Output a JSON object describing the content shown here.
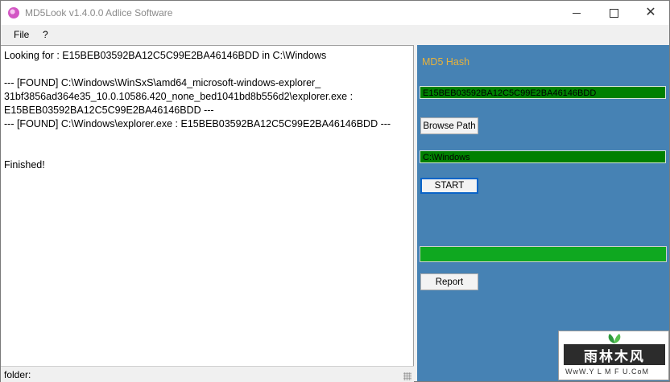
{
  "window": {
    "title": "MD5Look v1.4.0.0 Adlice Software",
    "minimize_icon": "minimize-icon",
    "maximize_icon": "maximize-icon",
    "close_glyph": "✕"
  },
  "menu": {
    "items": [
      "File",
      "?"
    ]
  },
  "output": {
    "lines": [
      "Looking for : E15BEB03592BA12C5C99E2BA46146BDD in C:\\Windows",
      "--- [FOUND] C:\\Windows\\WinSxS\\amd64_microsoft-windows-explorer_",
      "31bf3856ad364e35_10.0.10586.420_none_bed1041bd8b556d2\\explorer.exe :",
      "E15BEB03592BA12C5C99E2BA46146BDD ---",
      "--- [FOUND] C:\\Windows\\explorer.exe : E15BEB03592BA12C5C99E2BA46146BDD ---",
      "Finished!"
    ]
  },
  "sidebar": {
    "md5_label": "MD5 Hash",
    "hash_value": "E15BEB03592BA12C5C99E2BA46146BDD",
    "browse_label": "Browse Path",
    "path_value": "C:\\Windows",
    "start_label": "START",
    "report_label": "Report",
    "progress_fraction": 1.0
  },
  "status": {
    "text": "folder:"
  },
  "watermark": {
    "main": "雨林木风",
    "sub": "WwW.Y L M F U.CoM"
  },
  "colors": {
    "sidebar_bg": "#4682b4",
    "field_green": "#008000",
    "progress_green": "#0fa820",
    "label_gold": "#e8b23b"
  }
}
